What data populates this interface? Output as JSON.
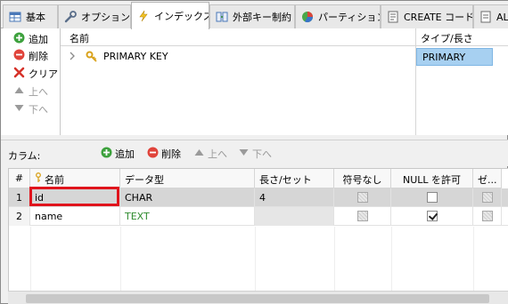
{
  "tabs": [
    {
      "label": "基本",
      "icon": "table-icon"
    },
    {
      "label": "オプション",
      "icon": "wrench-icon"
    },
    {
      "label": "インデックス",
      "icon": "lightning-icon"
    },
    {
      "label": "外部キー制約",
      "icon": "foreign-key-icon"
    },
    {
      "label": "パーティション",
      "icon": "partition-icon"
    },
    {
      "label": "CREATE コード",
      "icon": "code-icon"
    },
    {
      "label": "AL",
      "icon": "alter-icon"
    }
  ],
  "index_actions": {
    "add": "追加",
    "delete": "削除",
    "clear": "クリア",
    "up": "上へ",
    "down": "下へ"
  },
  "index_table": {
    "headers": {
      "name": "名前",
      "type": "タイプ/長さ"
    },
    "rows": [
      {
        "name": "PRIMARY KEY",
        "type": "PRIMARY"
      }
    ]
  },
  "columns_toolbar": {
    "label": "カラム:",
    "add": "追加",
    "delete": "削除",
    "up": "上へ",
    "down": "下へ"
  },
  "columns_table": {
    "headers": {
      "num": "#",
      "name": "名前",
      "datatype": "データ型",
      "length": "長さ/セット",
      "unsigned": "符号なし",
      "allow_null": "NULL を許可",
      "zerofill": "ゼ..."
    },
    "rows": [
      {
        "num": "1",
        "name": "id",
        "datatype": "CHAR",
        "length": "4",
        "unsigned": false,
        "allow_null": false,
        "zerofill": false
      },
      {
        "num": "2",
        "name": "name",
        "datatype": "TEXT",
        "length": "",
        "unsigned": false,
        "allow_null": true,
        "zerofill": false
      }
    ]
  },
  "colors": {
    "selection_blue": "#a7d0f1",
    "highlight_red": "#e0141c",
    "text_type_green": "#2e8b2e",
    "key_gold": "#d9a21b"
  }
}
